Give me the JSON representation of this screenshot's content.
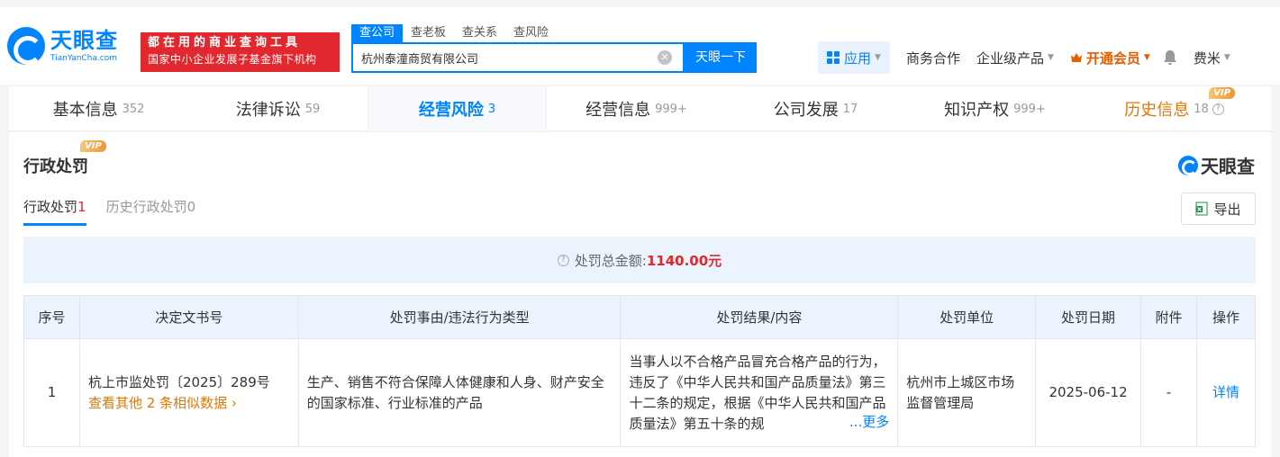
{
  "header": {
    "logo_cn": "天眼查",
    "logo_en": "TianYanCha.com",
    "slogan_line1": "都在用的商业查询工具",
    "slogan_line2": "国家中小企业发展子基金旗下机构",
    "search_tabs": [
      "查公司",
      "查老板",
      "查关系",
      "查风险"
    ],
    "search_value": "杭州泰潼商贸有限公司",
    "search_button": "天眼一下",
    "nav": {
      "apps": "应用",
      "business": "商务合作",
      "enterprise": "企业级产品",
      "vip": "开通会员",
      "user": "费米"
    }
  },
  "main_tabs": [
    {
      "label": "基本信息",
      "count": "352"
    },
    {
      "label": "法律诉讼",
      "count": "59"
    },
    {
      "label": "经营风险",
      "count": "3"
    },
    {
      "label": "经营信息",
      "count": "999+"
    },
    {
      "label": "公司发展",
      "count": "17"
    },
    {
      "label": "知识产权",
      "count": "999+"
    },
    {
      "label": "历史信息",
      "count": "18"
    }
  ],
  "vip_badge": "VIP",
  "section": {
    "title": "行政处罚",
    "brand": "天眼查",
    "sub_tabs": [
      {
        "label": "行政处罚",
        "count": "1"
      },
      {
        "label": "历史行政处罚",
        "count": "0"
      }
    ],
    "export": "导出",
    "summary_label": "处罚总金额:",
    "summary_amount": "1140.00元"
  },
  "table": {
    "headers": [
      "序号",
      "决定文书号",
      "处罚事由/违法行为类型",
      "处罚结果/内容",
      "处罚单位",
      "处罚日期",
      "附件",
      "操作"
    ],
    "rows": [
      {
        "index": "1",
        "doc_no": "杭上市监处罚〔2025〕289号",
        "similar": "查看其他 2 条相似数据",
        "reason": "生产、销售不符合保障人体健康和人身、财产安全的国家标准、行业标准的产品",
        "result": "当事人以不合格产品冒充合格产品的行为，违反了《中华人民共和国产品质量法》第三十二条的规定，根据《中华人民共和国产品质量法》第五十条的规",
        "more": "...更多",
        "unit": "杭州市上城区市场监督管理局",
        "date": "2025-06-12",
        "attachment": "-",
        "action": "详情"
      }
    ]
  }
}
